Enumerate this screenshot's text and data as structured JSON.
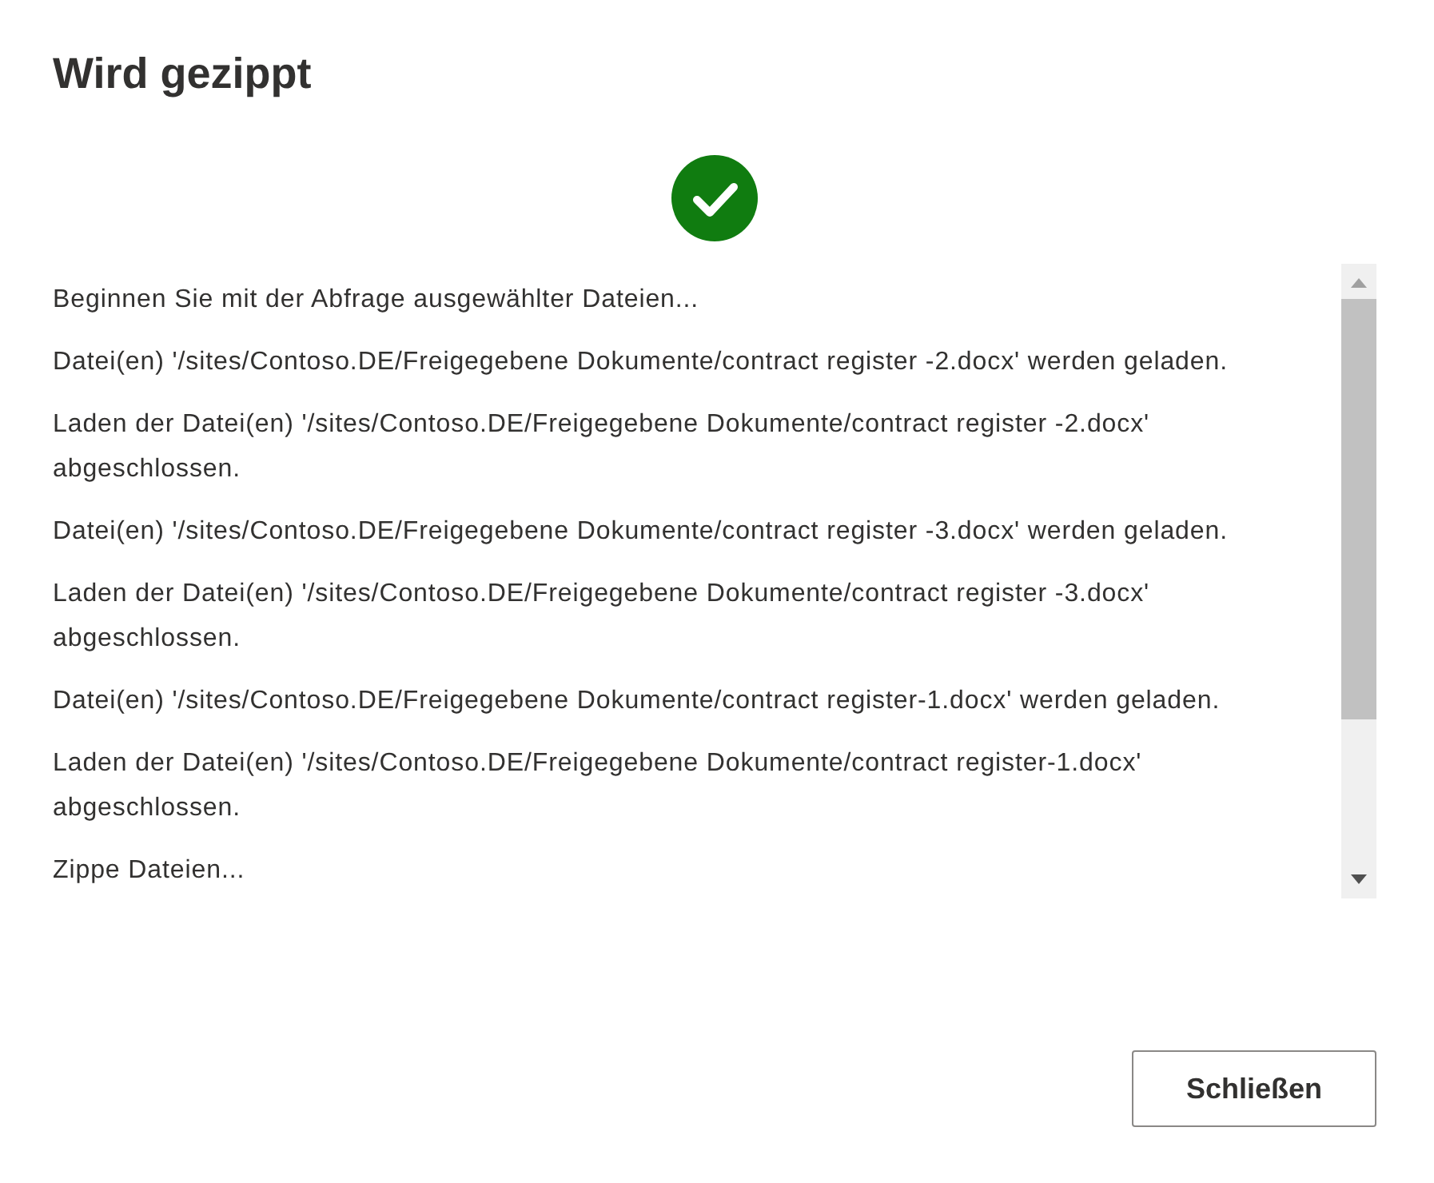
{
  "dialog": {
    "title": "Wird gezippt",
    "log": [
      "Beginnen Sie mit der Abfrage ausgewählter Dateien...",
      "Datei(en) '/sites/Contoso.DE/Freigegebene Dokumente/contract register -2.docx' werden geladen.",
      "Laden der Datei(en) '/sites/Contoso.DE/Freigegebene Dokumente/contract register -2.docx' abgeschlossen.",
      "Datei(en) '/sites/Contoso.DE/Freigegebene Dokumente/contract register -3.docx' werden geladen.",
      "Laden der Datei(en) '/sites/Contoso.DE/Freigegebene Dokumente/contract register -3.docx' abgeschlossen.",
      "Datei(en) '/sites/Contoso.DE/Freigegebene Dokumente/contract register-1.docx' werden geladen.",
      "Laden der Datei(en) '/sites/Contoso.DE/Freigegebene Dokumente/contract register-1.docx' abgeschlossen.",
      "Zippe Dateien..."
    ],
    "buttons": [
      "Schließen"
    ]
  }
}
